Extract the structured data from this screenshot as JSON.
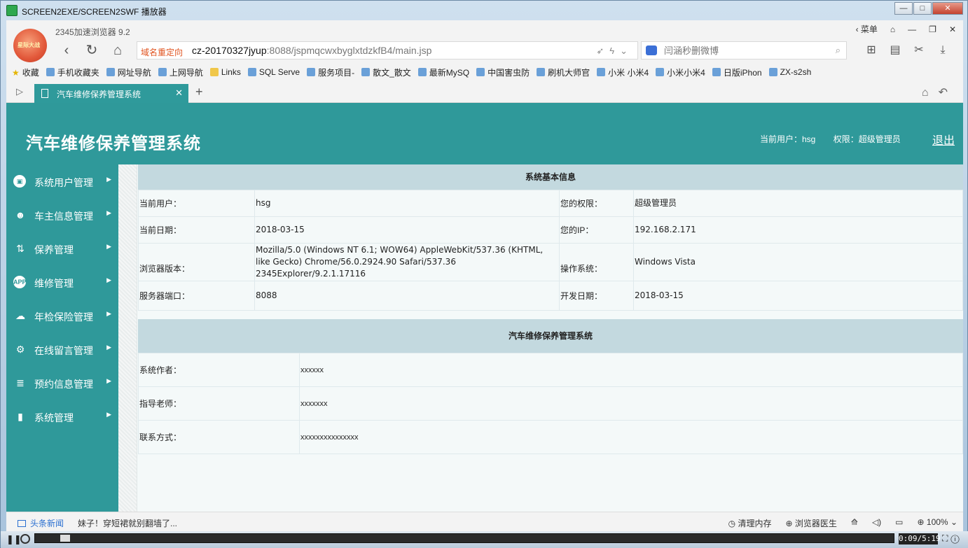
{
  "player": {
    "title": "SCREEN2EXE/SCREEN2SWF 播放器",
    "time": "0:09/5:19",
    "progress": 0.03
  },
  "browser": {
    "app_name": "2345加速浏览器 9.2",
    "logo_text": "星际大战",
    "redirect_label": "域名重定向",
    "url_host": "cz-20170327jyup",
    "url_rest": ":8088/jspmqcwxbyglxtdzkfB4/main.jsp",
    "search_placeholder": "闫涵秒删微博",
    "menu_label": "菜单",
    "bookmarks": [
      {
        "label": "收藏",
        "type": "star"
      },
      {
        "label": "手机收藏夹",
        "type": "page"
      },
      {
        "label": "网址导航",
        "type": "page"
      },
      {
        "label": "上网导航",
        "type": "page"
      },
      {
        "label": "Links",
        "type": "folder"
      },
      {
        "label": "SQL Serve",
        "type": "page"
      },
      {
        "label": "服务项目-",
        "type": "page"
      },
      {
        "label": "散文_散文",
        "type": "page"
      },
      {
        "label": "最新MySQ",
        "type": "page"
      },
      {
        "label": "中国害虫防",
        "type": "page"
      },
      {
        "label": "刷机大师官",
        "type": "page"
      },
      {
        "label": "小米 小米4",
        "type": "page"
      },
      {
        "label": "小米小米4",
        "type": "page"
      },
      {
        "label": "日版iPhon",
        "type": "page"
      },
      {
        "label": "ZX-s2sh",
        "type": "page"
      }
    ],
    "tab_title": "汽车维修保养管理系统",
    "status": {
      "news_label": "头条新闻",
      "headline": "妹子！穿短裙就别翻墙了...",
      "clean_memory": "清理内存",
      "doctor": "浏览器医生",
      "zoom": "100%"
    }
  },
  "page": {
    "title": "汽车维修保养管理系统",
    "current_user": "当前用户：hsg",
    "role": "权限：超级管理员",
    "logout": "退出",
    "menu": [
      {
        "label": "系统用户管理",
        "icon": "monitor-icon",
        "glyph": "▣"
      },
      {
        "label": "车主信息管理",
        "icon": "user-gear-icon",
        "glyph": "☻"
      },
      {
        "label": "保养管理",
        "icon": "sort-arrows-icon",
        "glyph": "⇅"
      },
      {
        "label": "维修管理",
        "icon": "app-icon",
        "glyph": "APP"
      },
      {
        "label": "年检保险管理",
        "icon": "cloud-icon",
        "glyph": "☁"
      },
      {
        "label": "在线留言管理",
        "icon": "gear-icon",
        "glyph": "⚙"
      },
      {
        "label": "预约信息管理",
        "icon": "stack-icon",
        "glyph": "≣"
      },
      {
        "label": "系统管理",
        "icon": "chart-icon",
        "glyph": "▮"
      }
    ],
    "section1": {
      "heading": "系统基本信息",
      "rows": [
        {
          "k1": "当前用户：",
          "v1": "hsg",
          "k2": "您的权限：",
          "v2": "超级管理员"
        },
        {
          "k1": "当前日期：",
          "v1": "2018-03-15",
          "k2": "您的IP：",
          "v2": "192.168.2.171"
        },
        {
          "k1": "浏览器版本：",
          "v1": "Mozilla/5.0 (Windows NT 6.1; WOW64) AppleWebKit/537.36 (KHTML, like Gecko) Chrome/56.0.2924.90 Safari/537.36 2345Explorer/9.2.1.17116",
          "k2": "操作系统：",
          "v2": "Windows Vista"
        },
        {
          "k1": "服务器端口：",
          "v1": "8088",
          "k2": "开发日期：",
          "v2": "2018-03-15"
        }
      ]
    },
    "section2": {
      "heading": "汽车维修保养管理系统",
      "rows": [
        {
          "k": "系统作者：",
          "v": "xxxxxx"
        },
        {
          "k": "指导老师：",
          "v": "xxxxxxx"
        },
        {
          "k": "联系方式：",
          "v": "xxxxxxxxxxxxxxx"
        }
      ]
    }
  }
}
